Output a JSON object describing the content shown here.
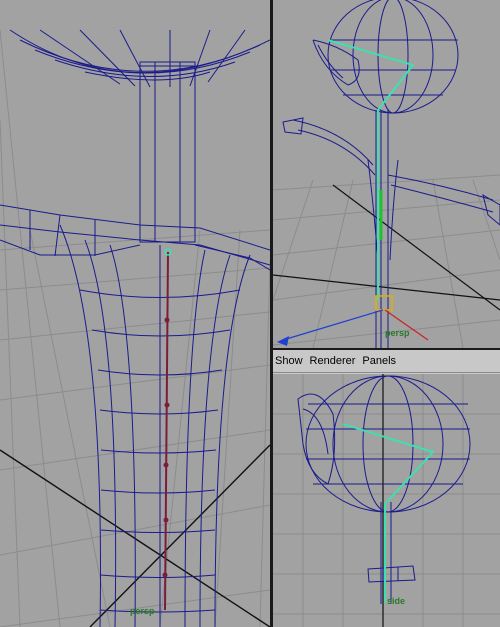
{
  "viewports": {
    "left": {
      "camera_label": "persp"
    },
    "top_right": {
      "camera_label": "persp"
    },
    "bottom_right": {
      "camera_label": "side"
    }
  },
  "panel_menu": {
    "items": [
      "Show",
      "Renderer",
      "Panels"
    ]
  },
  "colors": {
    "viewport_bg": "#a2a2a2",
    "grid": "#8c8c8c",
    "grid_axis": "#111111",
    "wireframe": "#1b1b8c",
    "joint": "#3fe0b0",
    "selection": "#e0b000",
    "label": "#2a7a2a"
  }
}
